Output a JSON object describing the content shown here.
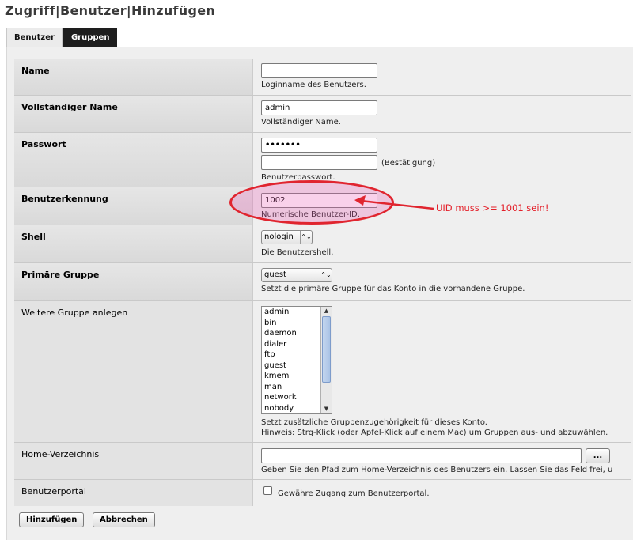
{
  "page": {
    "title": "Zugriff|Benutzer|Hinzufügen"
  },
  "tabs": [
    {
      "label": "Benutzer",
      "active": false
    },
    {
      "label": "Gruppen",
      "active": true
    }
  ],
  "form": {
    "name": {
      "label": "Name",
      "value": "",
      "hint": "Loginname des Benutzers."
    },
    "fullname": {
      "label": "Vollständiger Name",
      "value": "admin",
      "hint": "Vollständiger Name."
    },
    "password": {
      "label": "Passwort",
      "value": "•••••••",
      "confirm_value": "",
      "confirm_label": "(Bestätigung)",
      "hint": "Benutzerpasswort."
    },
    "uid": {
      "label": "Benutzerkennung",
      "value": "1002",
      "hint": "Numerische Benutzer-ID."
    },
    "shell": {
      "label": "Shell",
      "value": "nologin",
      "hint": "Die Benutzershell."
    },
    "primary_group": {
      "label": "Primäre Gruppe",
      "value": "guest",
      "hint": "Setzt die primäre Gruppe für das Konto in die vorhandene Gruppe."
    },
    "more_groups": {
      "label": "Weitere Gruppe anlegen",
      "options": [
        "admin",
        "bin",
        "daemon",
        "dialer",
        "ftp",
        "guest",
        "kmem",
        "man",
        "network",
        "nobody"
      ],
      "hint1": "Setzt zusätzliche Gruppenzugehörigkeit für dieses Konto.",
      "hint2": "Hinweis: Strg-Klick (oder Apfel-Klick auf einem Mac) um Gruppen aus- und abzuwählen."
    },
    "home": {
      "label": "Home-Verzeichnis",
      "value": "",
      "browse_label": "...",
      "hint": "Geben Sie den Pfad zum Home-Verzeichnis des Benutzers ein. Lassen Sie das Feld frei, u"
    },
    "portal": {
      "label": "Benutzerportal",
      "checkbox_label": "Gewähre Zugang zum Benutzerportal.",
      "checked": false
    }
  },
  "buttons": {
    "add": "Hinzufügen",
    "cancel": "Abbrechen"
  },
  "annotation": {
    "text": "UID muss >= 1001 sein!",
    "color": "#e0252f"
  }
}
